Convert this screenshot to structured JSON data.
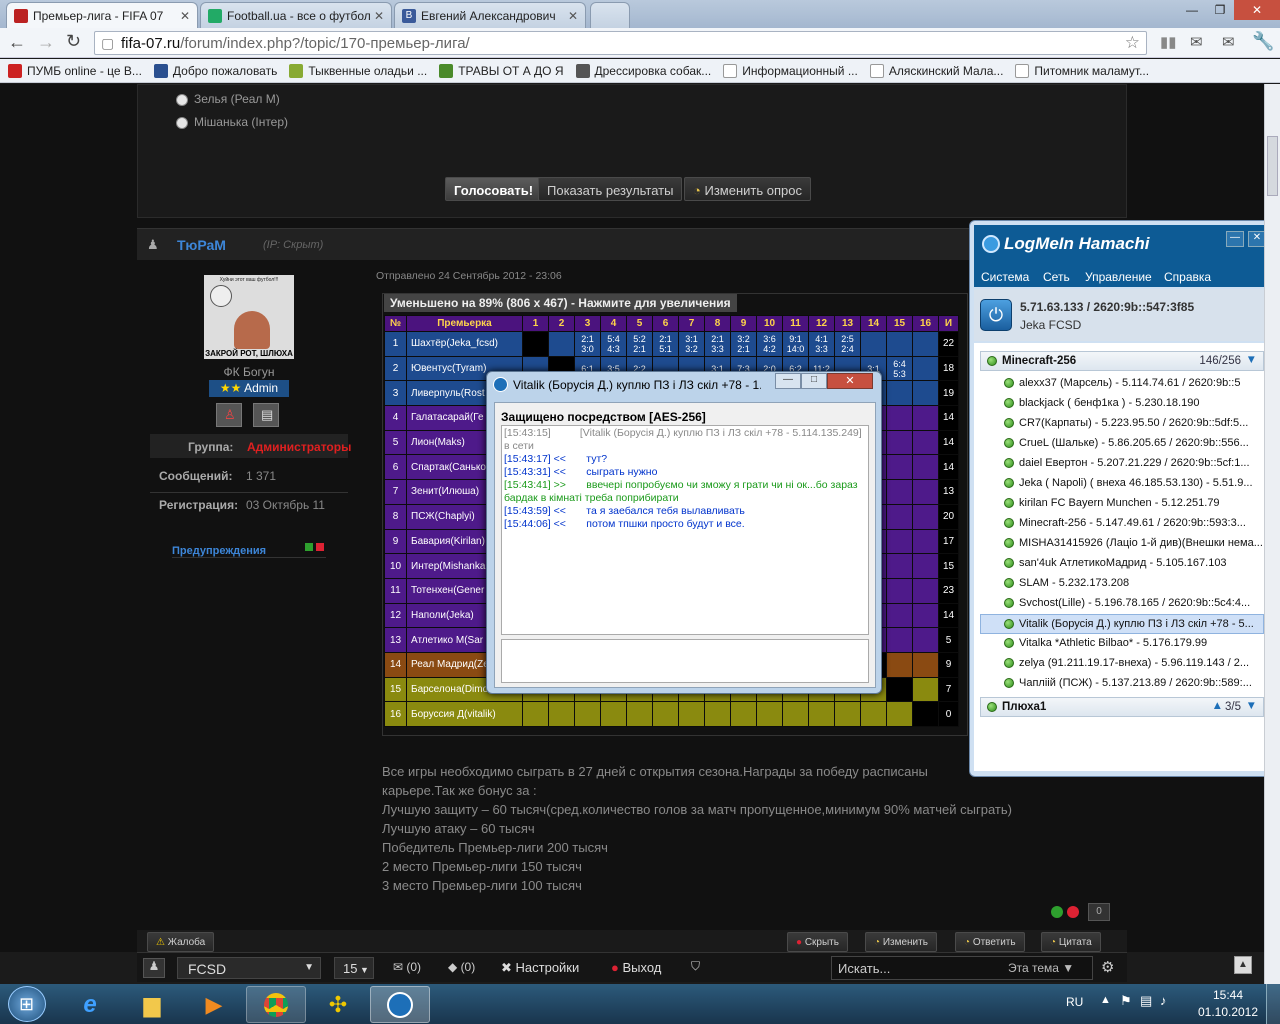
{
  "browser": {
    "tabs": [
      {
        "title": "Премьер-лига - FIFA 07",
        "color": "#b22"
      },
      {
        "title": "Football.ua - все о футбол",
        "color": "#2a6"
      },
      {
        "title": "Евгений Александрович",
        "color": "#3a5a9a"
      }
    ],
    "url_host": "fifa-07.ru",
    "url_path": "/forum/index.php?/topic/170-премьер-лига/",
    "bookmarks": [
      {
        "label": "ПУМБ online - це В...",
        "color": "#c22"
      },
      {
        "label": "Добро пожаловать",
        "color": "#2a4f8f"
      },
      {
        "label": "Тыквенные оладьи ...",
        "color": "#8a3"
      },
      {
        "label": "ТРАВЫ ОТ А ДО Я",
        "color": "#4a8a2a"
      },
      {
        "label": "Дрессировка собак...",
        "color": "#555"
      },
      {
        "label": "Информационный ...",
        "color": "#eee"
      },
      {
        "label": "Аляскинский Мала...",
        "color": "#eee"
      },
      {
        "label": "Питомник маламут...",
        "color": "#eee"
      }
    ]
  },
  "poll": {
    "options": [
      "Зелья (Реал М)",
      "Мішанька (Інтер)"
    ],
    "vote_label": "Голосовать!",
    "results_label": "Показать результаты",
    "edit_label": "Изменить опрос"
  },
  "post": {
    "author": "ТюРаМ",
    "ip": "(IP: Скрыт)",
    "date": "Отправлено 24 Сентябрь 2012 - 23:06",
    "avatar_top": "Хуйни этот ваш футбол!!!",
    "avatar_bottom": "ЗАКРОЙ РОТ, ШЛЮХА",
    "club": "ФК Богун",
    "rank": "Admin",
    "group_label": "Группа:",
    "group_value": "Администраторы",
    "posts_label": "Сообщений:",
    "posts_value": "1 371",
    "reg_label": "Регистрация:",
    "reg_value": "03 Октябрь 11",
    "warnings": "Предупреждения",
    "image_caption": "Уменьшено на 89% (806 x 467) - Нажмите для увеличения",
    "body": [
      "Все игры необходимо сыграть в 27 дней с открытия сезона.Награды за победу расписаны",
      "карьере.Так же бонус за :",
      "Лучшую защиту – 60 тысяч(сред.количество голов за матч пропущенное,минимум 90% матчей сыграть)",
      "Лучшую атаку – 60 тысяч",
      "Победитель Премьер-лиги 200 тысяч",
      "2 место Премьер-лиги 150 тысяч",
      "3 место Премьер-лиги 100 тысяч"
    ],
    "rating": "0",
    "actions": {
      "report": "Жалоба",
      "hide": "Скрыть",
      "edit": "Изменить",
      "reply": "Ответить",
      "quote": "Цитата"
    }
  },
  "league_table": {
    "headers": [
      "№",
      "Премьерка",
      "1",
      "2",
      "3",
      "4",
      "5",
      "6",
      "7",
      "8",
      "9",
      "10",
      "11",
      "12",
      "13",
      "14",
      "15",
      "16",
      "И"
    ],
    "rows": [
      {
        "n": "1",
        "team": "Шахтёр(Jeka_fcsd)",
        "color": "blue",
        "cells": [
          "",
          "",
          "2:1 3:0",
          "5:4 4:3",
          "5:2 2:1",
          "2:1 5:1",
          "3:1 3:2",
          "2:1 3:3",
          "3:2 2:1",
          "3:6 4:2",
          "9:1 14:0",
          "4:1 3:3",
          "2:5 2:4",
          "",
          "",
          ""
        ],
        "last": "22"
      },
      {
        "n": "2",
        "team": "Ювентус(Tyram)",
        "color": "blue",
        "cells": [
          "",
          "",
          "6:1",
          "3:5",
          "2:2",
          "",
          "",
          "3:1",
          "7:3",
          "2:0",
          "6:2",
          "11:2",
          "",
          "3:1",
          "6:4 5:3",
          ""
        ],
        "last": "18"
      },
      {
        "n": "3",
        "team": "Ливерпуль(Rost",
        "color": "blue",
        "cells": [],
        "last": "19"
      },
      {
        "n": "4",
        "team": "Галатасарай(Ге",
        "color": "purple",
        "cells": [],
        "last": "14"
      },
      {
        "n": "5",
        "team": "Лион(Maks)",
        "color": "purple",
        "cells": [],
        "last": "14"
      },
      {
        "n": "6",
        "team": "Спартак(Санько",
        "color": "purple",
        "cells": [],
        "last": "14"
      },
      {
        "n": "7",
        "team": "Зенит(Илюша)",
        "color": "purple",
        "cells": [],
        "last": "13"
      },
      {
        "n": "8",
        "team": "ПСЖ(Chaplyi)",
        "color": "purple",
        "cells": [],
        "last": "20"
      },
      {
        "n": "9",
        "team": "Бавария(Kirilan)",
        "color": "purple",
        "cells": [],
        "last": "17"
      },
      {
        "n": "10",
        "team": "Интер(Mishanka",
        "color": "purple",
        "cells": [],
        "last": "15"
      },
      {
        "n": "11",
        "team": "Тотенхен(Gener",
        "color": "purple",
        "cells": [],
        "last": "23"
      },
      {
        "n": "12",
        "team": "Наполи(Jeka)",
        "color": "purple",
        "cells": [],
        "last": "14"
      },
      {
        "n": "13",
        "team": "Атлетико М(Sar",
        "color": "purple",
        "cells": [],
        "last": "5"
      },
      {
        "n": "14",
        "team": "Реал Мадрид(Ze",
        "color": "orange",
        "cells": [],
        "last": "9"
      },
      {
        "n": "15",
        "team": "Барселона(Dimo",
        "color": "olive",
        "cells": [],
        "last": "7"
      },
      {
        "n": "16",
        "team": "Боруссия Д(vitalik)",
        "color": "olive",
        "cells": [],
        "last": "0"
      }
    ]
  },
  "chat": {
    "title": "Vitalik (Борусія Д.) куплю ПЗ і ЛЗ скіл +78 - 1...",
    "security": "Защищено посредством [AES-256]",
    "lines": [
      {
        "cls": "ln-grey",
        "text": "[15:43:15]          [Vitalik (Борусія Д.) куплю ПЗ і ЛЗ скіл +78 - 5.114.135.249] в сети"
      },
      {
        "cls": "ln-blue",
        "text": "[15:43:17] <<       тут?"
      },
      {
        "cls": "ln-blue",
        "text": "[15:43:31] <<       сыграть нужно"
      },
      {
        "cls": "ln-green",
        "text": "[15:43:41] >>       ввечері попробуємо чи зможу я грати чи ні ок...бо зараз бардак в кімнаті треба поприбирати"
      },
      {
        "cls": "ln-blue",
        "text": "[15:43:59] <<       та я заебался тебя вылавливать"
      },
      {
        "cls": "ln-blue",
        "text": "[15:44:06] <<       потом тпшки просто будут и все."
      }
    ]
  },
  "hamachi": {
    "brand": "LogMeIn Hamachi",
    "menu": [
      "Система",
      "Сеть",
      "Управление",
      "Справка"
    ],
    "ip": "5.71.63.133 / 2620:9b::547:3f85",
    "user": "Jeka FCSD",
    "network1": {
      "name": "Minecraft-256",
      "count": "146/256"
    },
    "members": [
      "alexx37 (Марсель) - 5.114.74.61 / 2620:9b::5",
      "blackjack ( бенф1ка ) - 5.230.18.190",
      "CR7(Карпаты) - 5.223.95.50 / 2620:9b::5df:5...",
      "CrueL (Шальке) - 5.86.205.65 / 2620:9b::556...",
      "daiel Евертон - 5.207.21.229 / 2620:9b::5cf:1...",
      "Jeka ( Napoli) ( внеха 46.185.53.130) - 5.51.9...",
      "kirilan FC Bayern Munchen - 5.12.251.79",
      "Minecraft-256 - 5.147.49.61 / 2620:9b::593:3...",
      "MISHA31415926 (Лаціо 1-й див)(Внешки нема...",
      "san'4uk АтлетикоМадрид - 5.105.167.103",
      "SLAM - 5.232.173.208",
      "Svchost(Lille) - 5.196.78.165 / 2620:9b::5c4:4...",
      "Vitalik (Борусія Д.) куплю ПЗ і ЛЗ скіл +78 - 5...",
      "Vitalka *Athletic Bilbao* - 5.176.179.99",
      "zelya (91.211.19.17-внеха) - 5.96.119.143 / 2...",
      "Чапліій (ПСЖ) - 5.137.213.89 / 2620:9b::589:..."
    ],
    "network2": {
      "name": "Плюха1",
      "count": "3/5"
    }
  },
  "forumbar": {
    "user": "FCSD",
    "per_page": "15",
    "messages": "(0)",
    "notifications": "(0)",
    "settings": "Настройки",
    "logout": "Выход",
    "search_placeholder": "Искать...",
    "scope": "Эта тема"
  },
  "taskbar": {
    "lang": "RU",
    "time": "15:44",
    "date": "01.10.2012"
  }
}
